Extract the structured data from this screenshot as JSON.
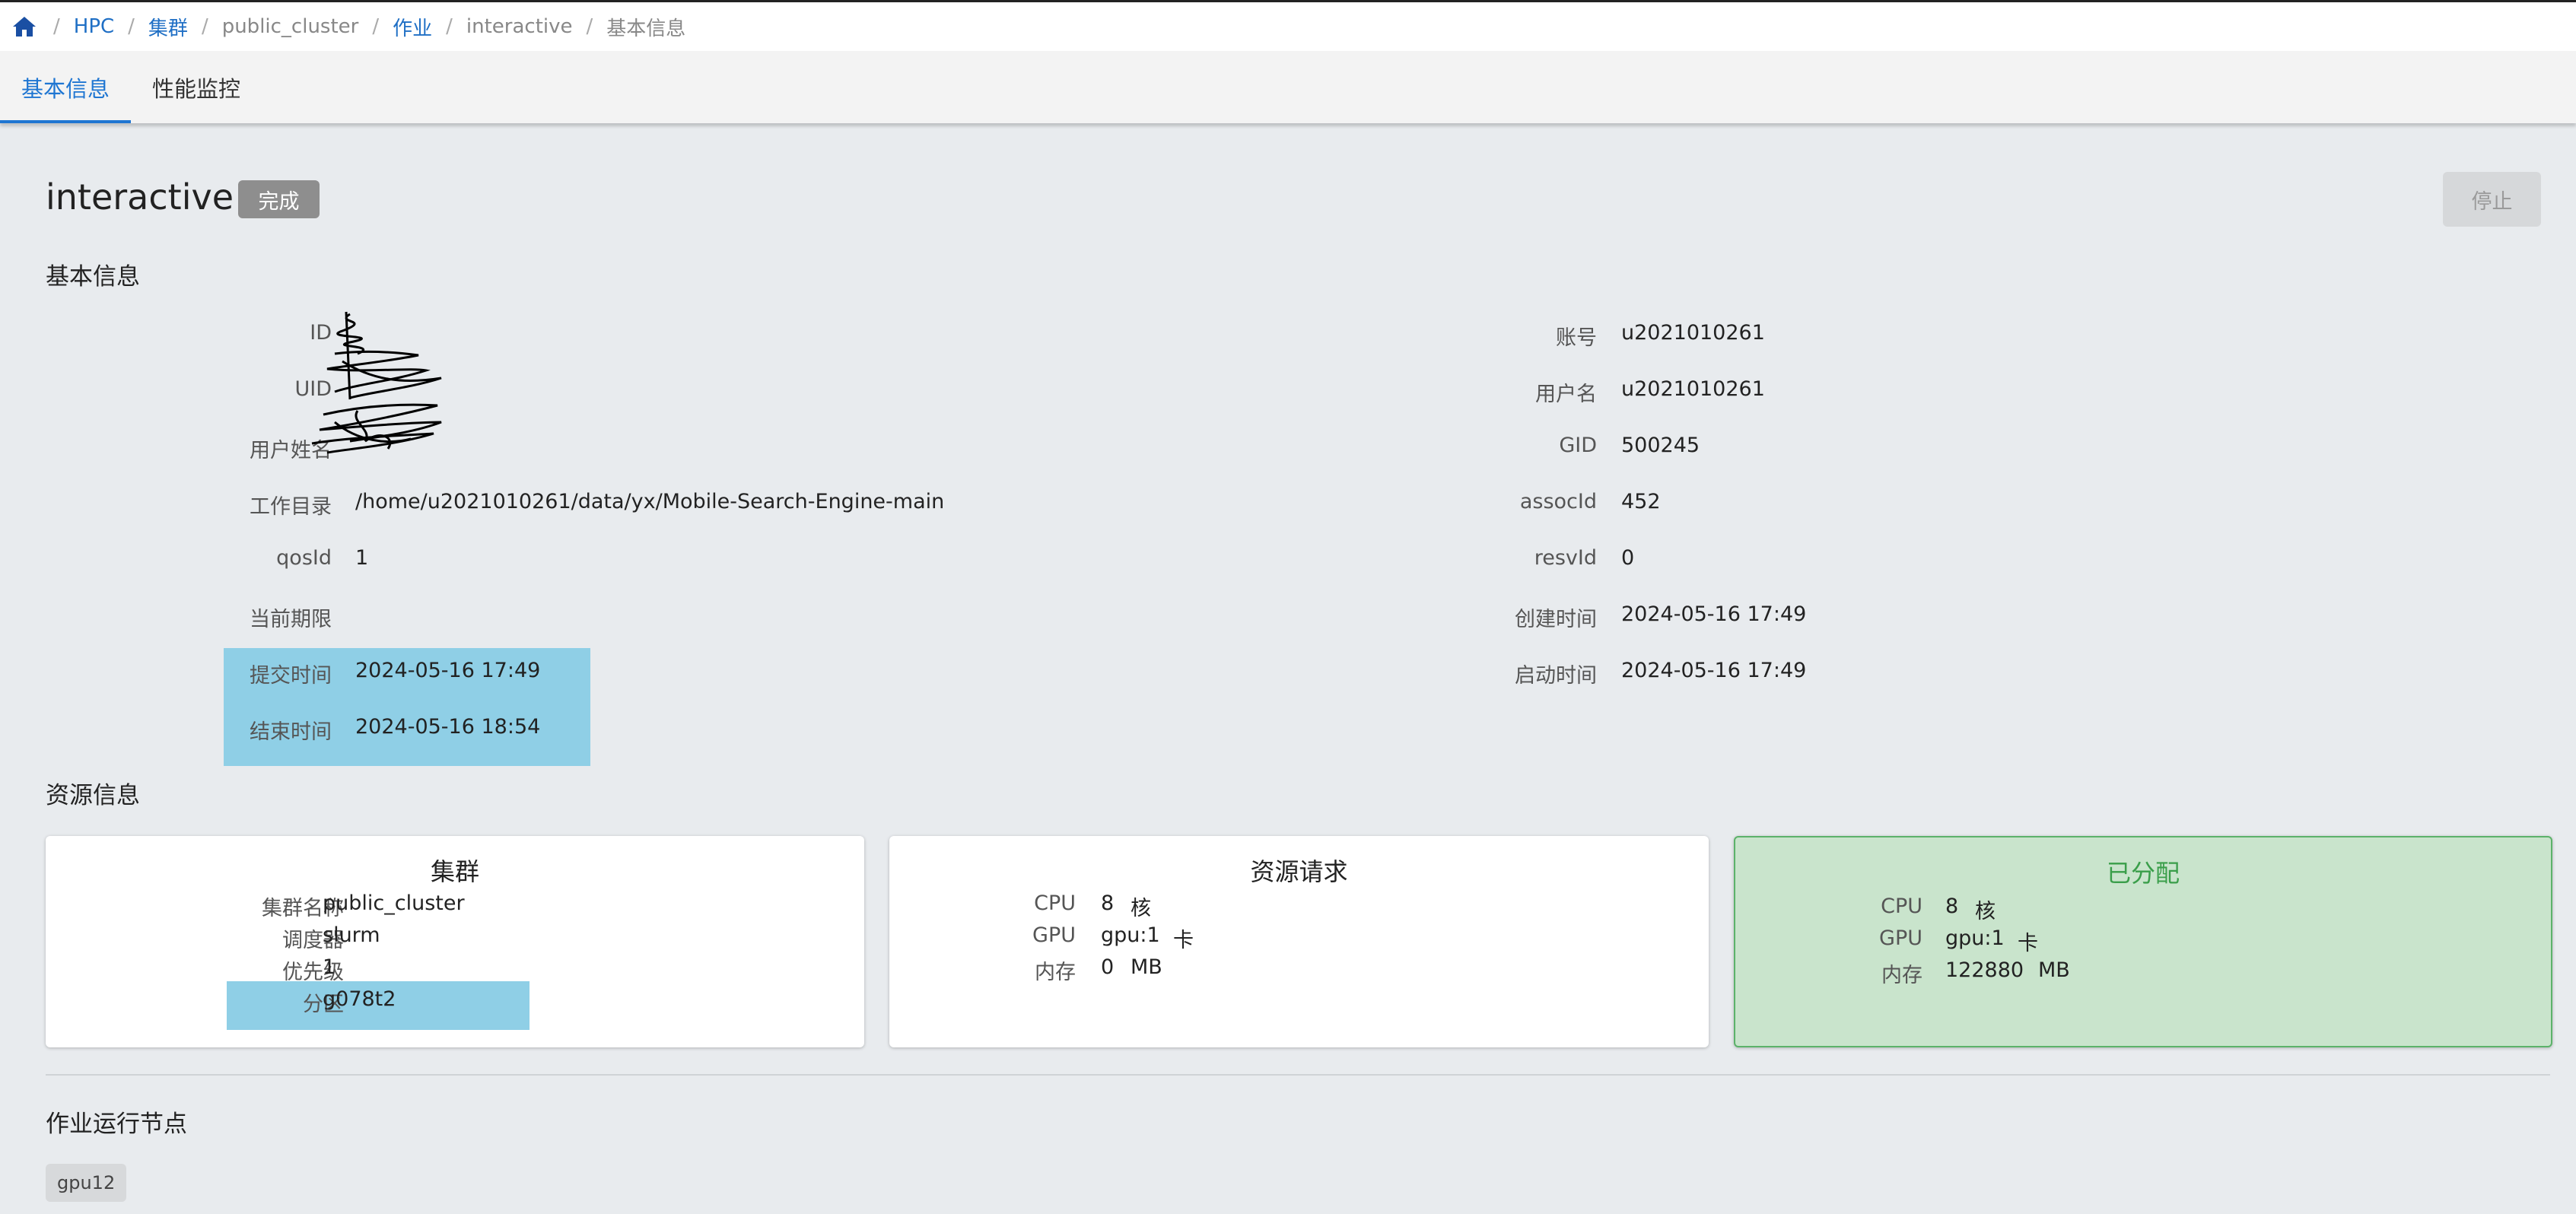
{
  "breadcrumb": {
    "items": [
      "HPC",
      "集群",
      "public_cluster",
      "作业",
      "interactive",
      "基本信息"
    ]
  },
  "tabs": [
    {
      "label": "基本信息",
      "active": true
    },
    {
      "label": "性能监控",
      "active": false
    }
  ],
  "job": {
    "name": "interactive",
    "status": "完成",
    "stop_label": "停止"
  },
  "basic_info": {
    "title": "基本信息",
    "left": [
      {
        "label": "ID",
        "value": ""
      },
      {
        "label": "UID",
        "value": ""
      },
      {
        "label": "用户姓名",
        "value": ""
      },
      {
        "label": "工作目录",
        "value": "/home/u2021010261/data/yx/Mobile-Search-Engine-main"
      },
      {
        "label": "qosId",
        "value": "1"
      },
      {
        "label": "当前期限",
        "value": ""
      },
      {
        "label": "提交时间",
        "value": "2024-05-16 17:49"
      },
      {
        "label": "结束时间",
        "value": "2024-05-16 18:54"
      }
    ],
    "right": [
      {
        "label": "账号",
        "value": "u2021010261"
      },
      {
        "label": "用户名",
        "value": "u2021010261"
      },
      {
        "label": "GID",
        "value": "500245"
      },
      {
        "label": "assocId",
        "value": "452"
      },
      {
        "label": "resvId",
        "value": "0"
      },
      {
        "label": "创建时间",
        "value": "2024-05-16 17:49"
      },
      {
        "label": "启动时间",
        "value": "2024-05-16 17:49"
      }
    ]
  },
  "resource_info": {
    "title": "资源信息",
    "cluster_card": {
      "title": "集群",
      "rows": [
        {
          "label": "集群名称",
          "value": "public_cluster"
        },
        {
          "label": "调度器",
          "value": "slurm"
        },
        {
          "label": "优先级",
          "value": "1"
        },
        {
          "label": "分区",
          "value": "g078t2"
        }
      ]
    },
    "request_card": {
      "title": "资源请求",
      "rows": [
        {
          "label": "CPU",
          "value": "8",
          "unit": "核"
        },
        {
          "label": "GPU",
          "value": "gpu:1",
          "unit": "卡"
        },
        {
          "label": "内存",
          "value": "0",
          "unit": "MB"
        }
      ]
    },
    "allocated_card": {
      "title": "已分配",
      "rows": [
        {
          "label": "CPU",
          "value": "8",
          "unit": "核"
        },
        {
          "label": "GPU",
          "value": "gpu:1",
          "unit": "卡"
        },
        {
          "label": "内存",
          "value": "122880",
          "unit": "MB"
        }
      ]
    }
  },
  "nodes": {
    "title": "作业运行节点",
    "items": [
      "gpu12"
    ]
  },
  "colors": {
    "accent": "#1f76d2",
    "status_badge": "#8e8e8e",
    "highlight": "#8fcfe6",
    "allocated_bg": "#c9e4cc",
    "allocated_title": "#3a9e4a"
  }
}
